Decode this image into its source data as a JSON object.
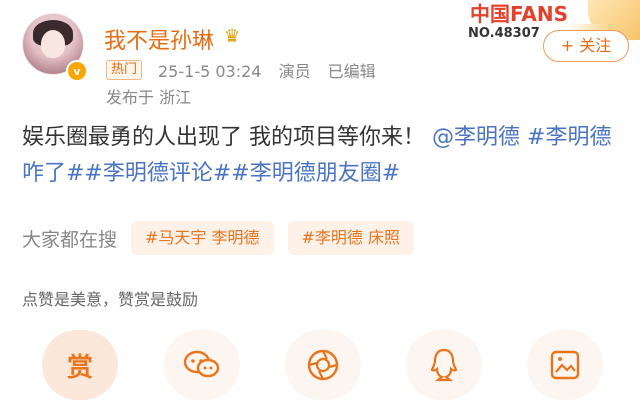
{
  "post": {
    "author": "我不是孙琳",
    "hot_tag": "热门",
    "date": "25-1-5 03:24",
    "role": "演员",
    "edited": "已编辑",
    "location": "发布于 浙江",
    "content_text": "娱乐圈最勇的人出现了 我的项目等你来！",
    "mention": "@李明德",
    "topics": "#李明德咋了##李明德评论##李明德朋友圈#"
  },
  "fans": {
    "logo_text": "中国FANS",
    "number": "NO.48307",
    "follow_label": "+ 关注"
  },
  "search": {
    "label": "大家都在搜",
    "chips": [
      "#马天宇 李明德",
      "#李明德 床照"
    ]
  },
  "reward": {
    "tip": "点赞是美意，赞赏是鼓励",
    "primary_label": "赏"
  },
  "icons": {
    "verified": "verified-badge-icon",
    "crown": "crown-icon",
    "wechat": "wechat-icon",
    "moments": "moments-icon",
    "qq": "qq-icon",
    "image": "image-share-icon"
  },
  "colors": {
    "accent": "#e86b12",
    "link": "#4a74c3"
  }
}
